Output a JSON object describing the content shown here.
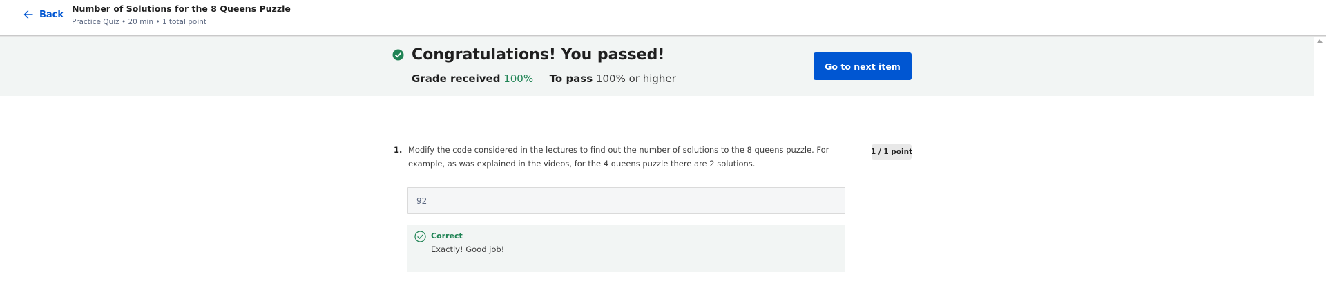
{
  "header": {
    "back_label": "Back",
    "title": "Number of Solutions for the 8 Queens Puzzle",
    "meta": "Practice Quiz • 20 min • 1 total point"
  },
  "banner": {
    "heading": "Congratulations! You passed!",
    "grade_label": "Grade received",
    "grade_value": "100%",
    "pass_label": "To pass",
    "pass_value": "100% or higher",
    "next_button_label": "Go to next item"
  },
  "question": {
    "number": "1.",
    "text": "Modify the code considered in the lectures to find out the number of solutions to the 8 queens puzzle. For example, as was explained in the videos, for the 4 queens puzzle there are 2 solutions.",
    "points": "1 / 1 point",
    "answer_value": "92",
    "feedback": {
      "status": "Correct",
      "message": "Exactly! Good job!"
    }
  },
  "colors": {
    "accent": "#0056d2",
    "success": "#1f8354",
    "banner_bg": "#f2f5f4"
  },
  "icons": {
    "back": "arrow-left-icon",
    "pass": "check-circle-filled-icon",
    "feedback": "check-circle-outline-icon"
  }
}
